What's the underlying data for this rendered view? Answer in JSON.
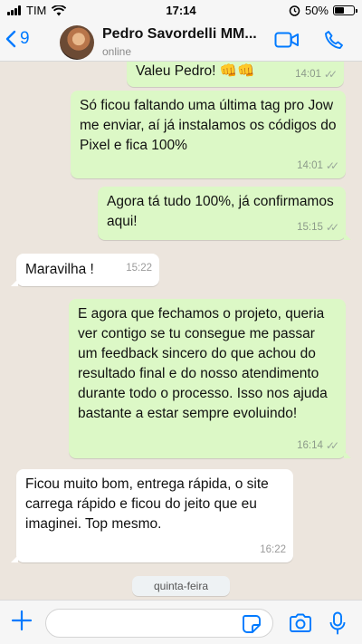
{
  "status_bar": {
    "carrier": "TIM",
    "time": "17:14",
    "battery": "50%",
    "battery_level": 0.5
  },
  "header": {
    "back_count": "9",
    "contact_name": "Pedro Savordelli MM...",
    "contact_status": "online"
  },
  "messages": [
    {
      "dir": "out",
      "text": "Valeu Pedro! 👊👊",
      "time": "14:01",
      "read": true
    },
    {
      "dir": "out",
      "text": "Só ficou faltando uma última tag pro Jow me enviar, aí já instalamos os códigos do Pixel e fica 100%",
      "time": "14:01",
      "read": true
    },
    {
      "dir": "out",
      "text": "Agora tá tudo 100%, já confirmamos aqui!",
      "time": "15:15",
      "read": true
    },
    {
      "dir": "in",
      "text": "Maravilha !",
      "time": "15:22"
    },
    {
      "dir": "out",
      "text": "E agora que fechamos o projeto, queria ver contigo se tu consegue me passar um feedback sincero do que achou do resultado final e do nosso atendimento durante todo o processo. Isso nos ajuda bastante a estar sempre evoluindo!",
      "time": "16:14",
      "read": true
    },
    {
      "dir": "in",
      "text": "Ficou muito bom, entrega rápida, o site carrega rápido e ficou do jeito que eu imaginei.  Top mesmo.",
      "time": "16:22"
    }
  ],
  "date_divider": "quinta-feira",
  "composer": {
    "placeholder": ""
  },
  "colors": {
    "accent": "#007aff",
    "outgoing": "#dcf8c6",
    "incoming": "#ffffff",
    "background": "#ece5dd"
  }
}
